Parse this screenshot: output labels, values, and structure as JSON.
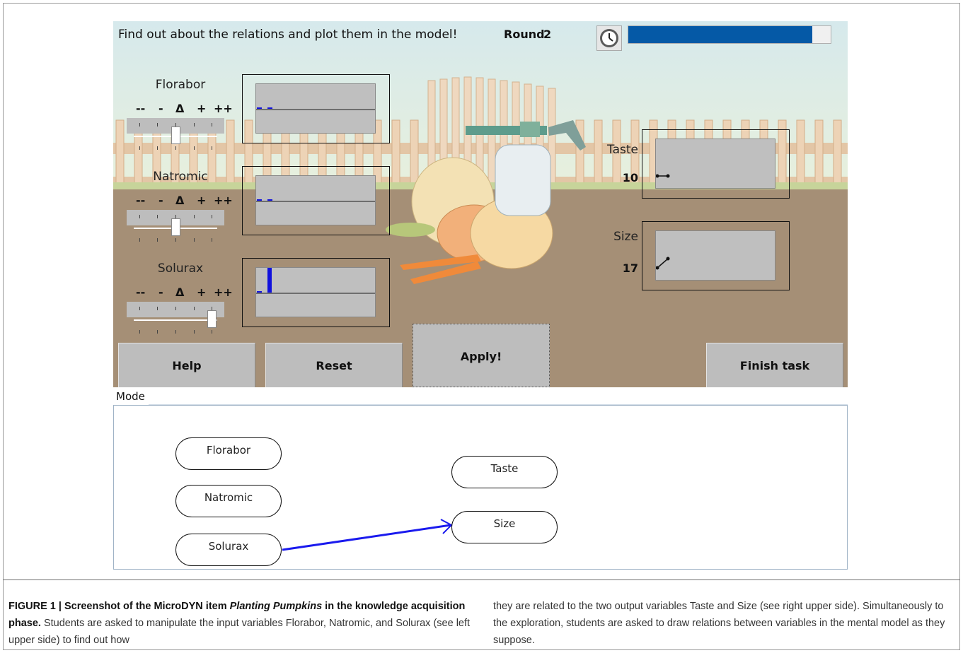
{
  "game": {
    "instruction": "Find out about the relations and plot them in the model!",
    "round_label": "Round",
    "round_value": "2",
    "timer_icon": "clock-icon",
    "timer_progress": 0.91,
    "colors": {
      "timer_fill": "#0559a6",
      "relation_blue": "#1111dd"
    },
    "control_labels": [
      "--",
      "-",
      "Δ",
      "+",
      "++"
    ],
    "inputs": [
      {
        "name": "Florabor",
        "slider_level": "0"
      },
      {
        "name": "Natromic",
        "slider_level": "0"
      },
      {
        "name": "Solurax",
        "slider_level": "++"
      }
    ],
    "outputs": [
      {
        "name": "Taste",
        "value": "10"
      },
      {
        "name": "Size",
        "value": "17"
      }
    ],
    "buttons": {
      "help": "Help",
      "reset": "Reset",
      "apply": "Apply!",
      "finish": "Finish task"
    }
  },
  "model": {
    "tab_label": "Mode",
    "nodes": {
      "florabor": "Florabor",
      "natromic": "Natromic",
      "solurax": "Solurax",
      "taste": "Taste",
      "size": "Size"
    },
    "relations": [
      {
        "from": "Solurax",
        "to": "Size"
      }
    ]
  },
  "caption": {
    "figure_label": "FIGURE 1 | Screenshot of the MicroDYN item ",
    "item_name": "Planting Pumpkins",
    "bold_tail": " in the knowledge acquisition phase.",
    "left_text": " Students are asked to manipulate the input variables Florabor, Natromic, and Solurax (see left upper side) to find out how",
    "right_text": "they are related to the two output variables Taste and Size (see right upper side). Simultaneously to the exploration, students are asked to draw relations between variables in the mental model as they suppose."
  }
}
